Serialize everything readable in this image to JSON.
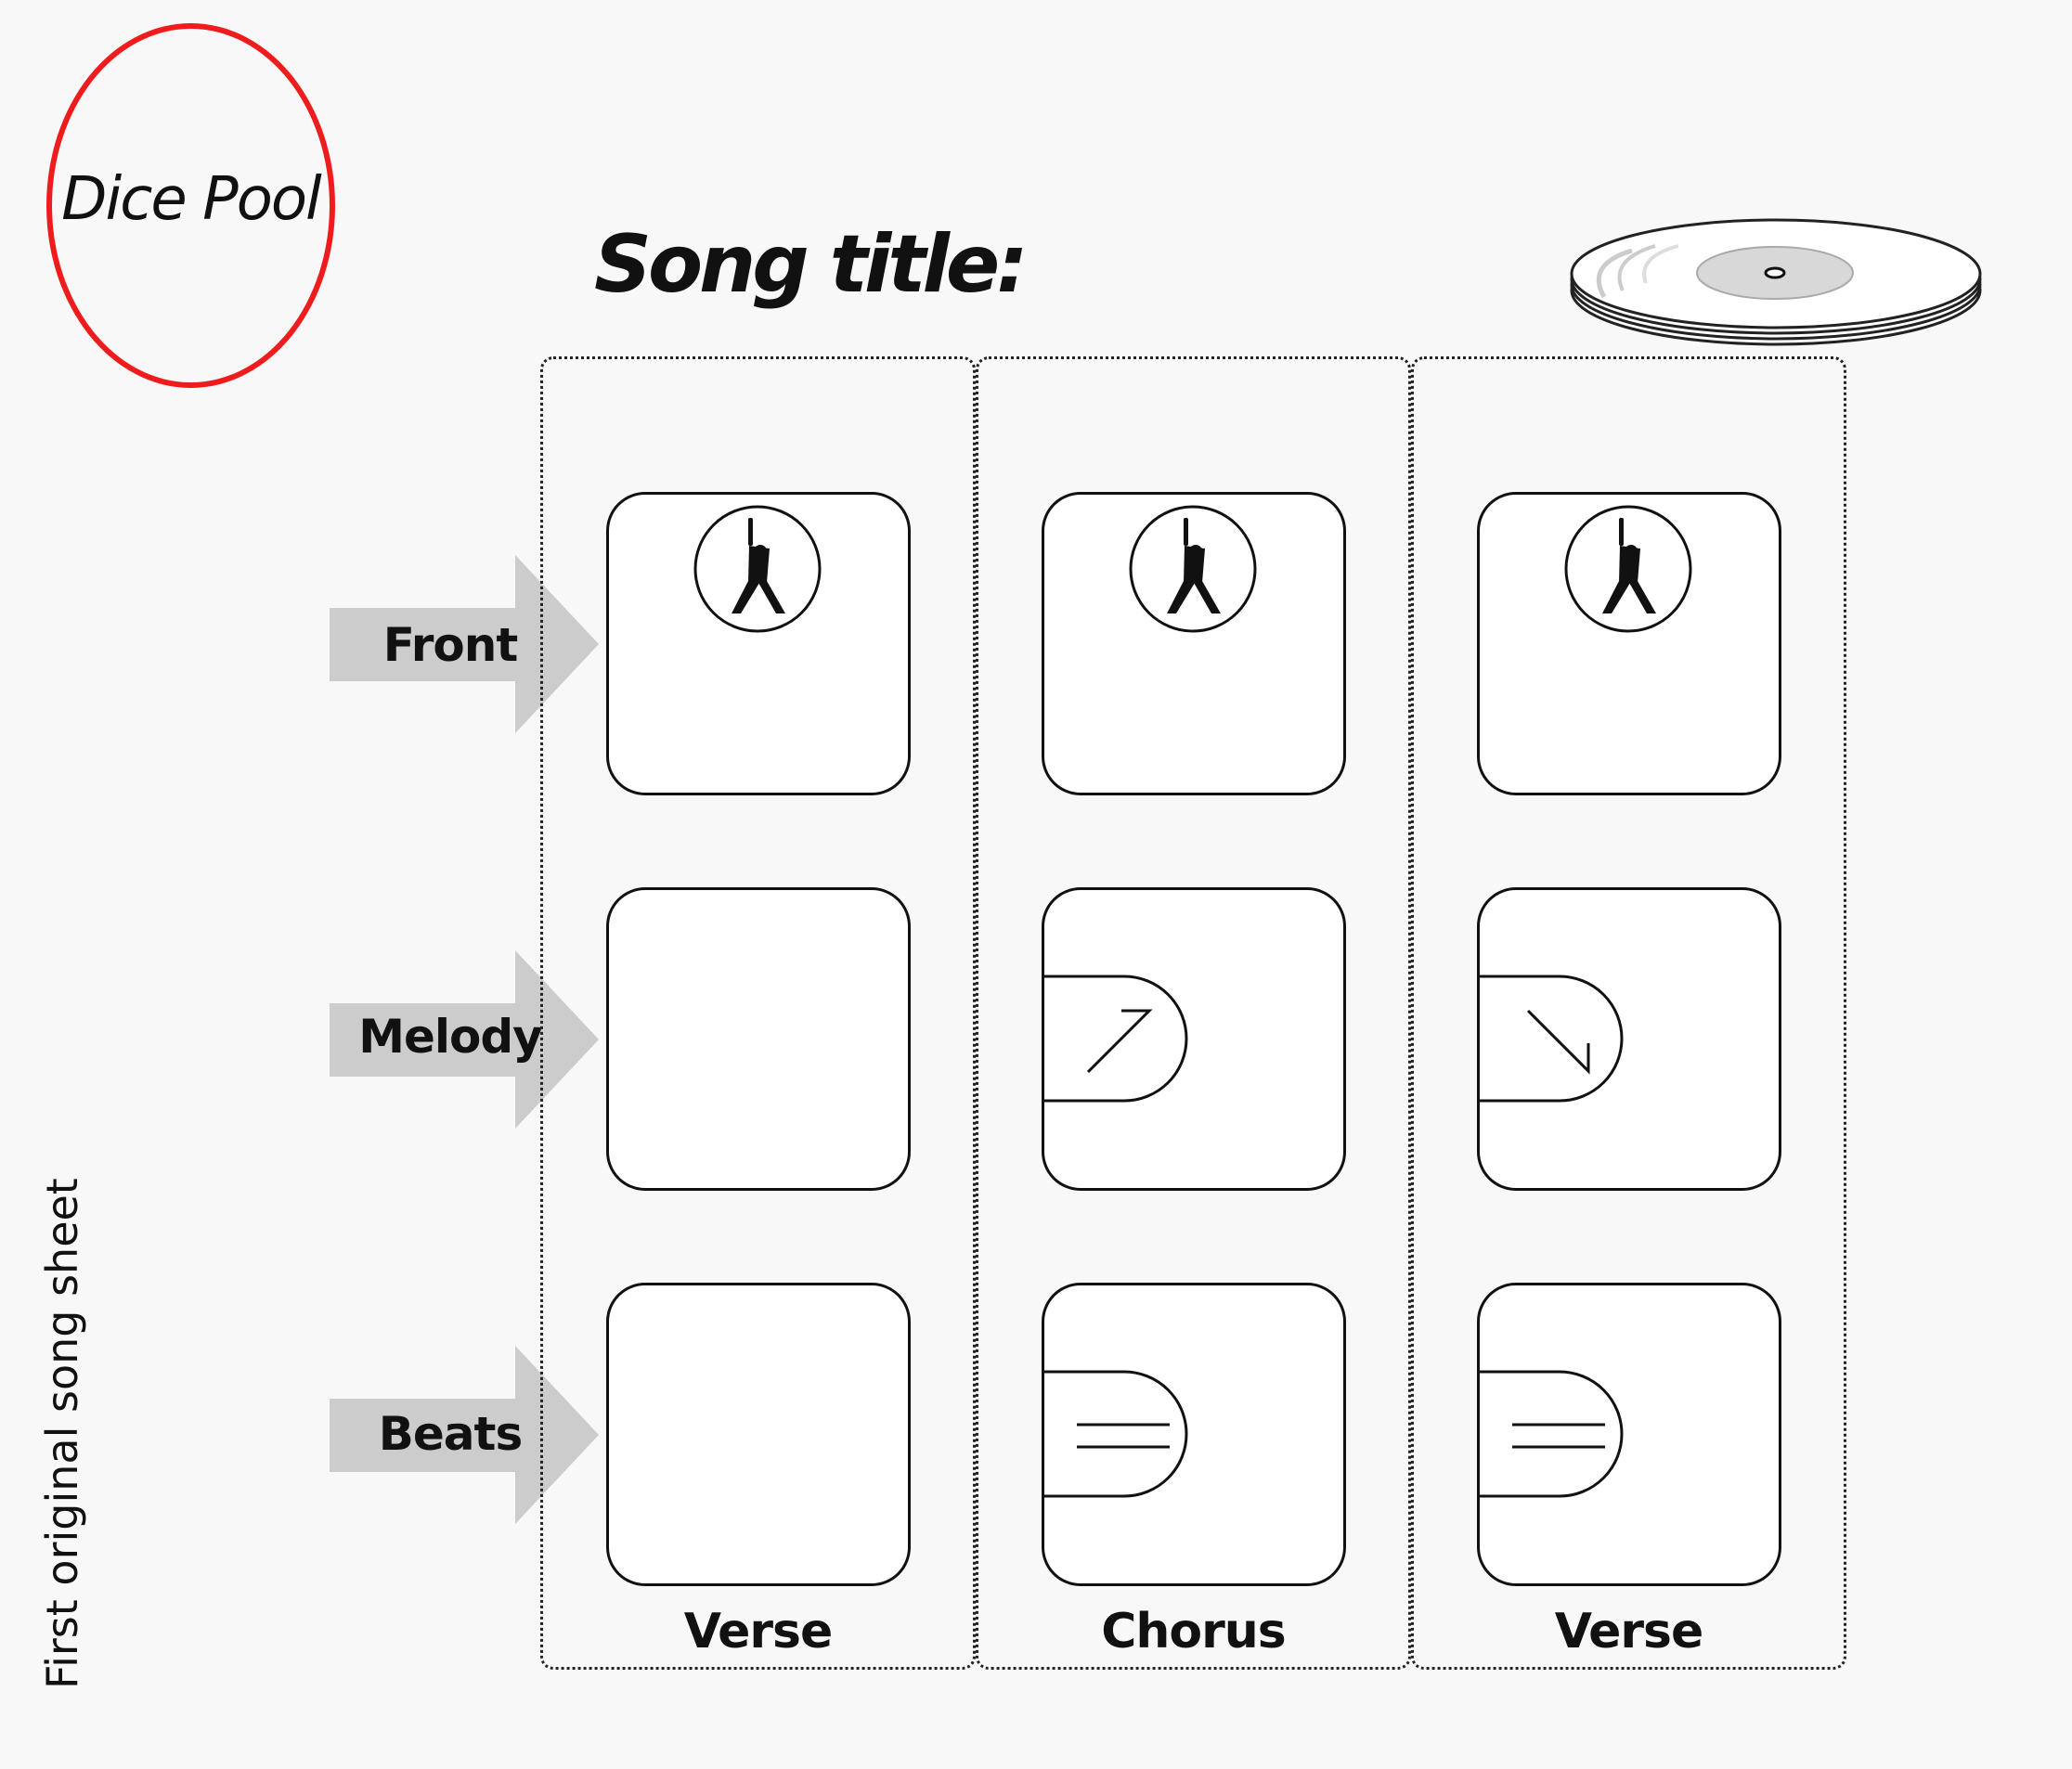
{
  "dice_pool": {
    "label": "Dice Pool"
  },
  "song_title": {
    "label": "Song title:"
  },
  "rows": [
    {
      "label": "Front"
    },
    {
      "label": "Melody"
    },
    {
      "label": "Beats"
    }
  ],
  "columns": [
    {
      "label": "Verse"
    },
    {
      "label": "Chorus"
    },
    {
      "label": "Verse"
    }
  ],
  "side_caption": "First original song sheet",
  "colors": {
    "background": "#f8f8f8",
    "dice_pool_border": "#ee1c1c",
    "arrow": "#cccccc",
    "ink": "#111111"
  },
  "icons": [
    "vinyl-record-icon",
    "performer-icon",
    "melody-up-icon",
    "melody-down-icon",
    "beats-lines-icon"
  ]
}
